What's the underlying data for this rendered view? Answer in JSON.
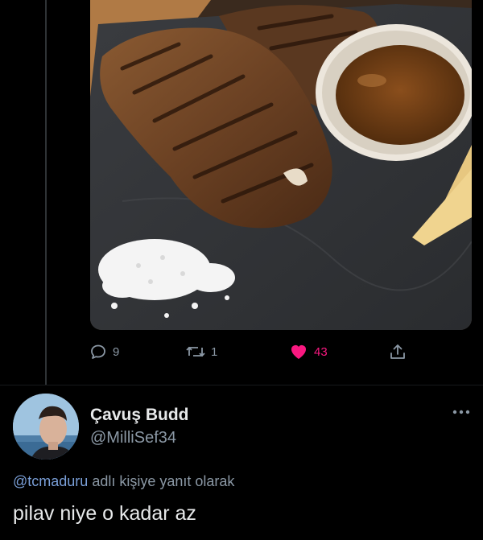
{
  "colors": {
    "background": "#000000",
    "text_primary": "#e7e9ea",
    "text_secondary": "#8b98a5",
    "like_active": "#f91880",
    "mention": "#7a9fd8"
  },
  "tweet": {
    "media_description": "photo",
    "stats": {
      "replies": "9",
      "retweets": "1",
      "likes": "43"
    }
  },
  "reply": {
    "author_name": "Çavuş Budd",
    "author_handle": "@MilliSef34",
    "reply_to_mention": "@tcmaduru",
    "reply_to_suffix": " adlı kişiye yanıt olarak",
    "text": "pilav niye o kadar az",
    "icons": [
      "reply-icon",
      "retweet-icon",
      "heart-icon",
      "share-icon",
      "more-icon"
    ]
  }
}
